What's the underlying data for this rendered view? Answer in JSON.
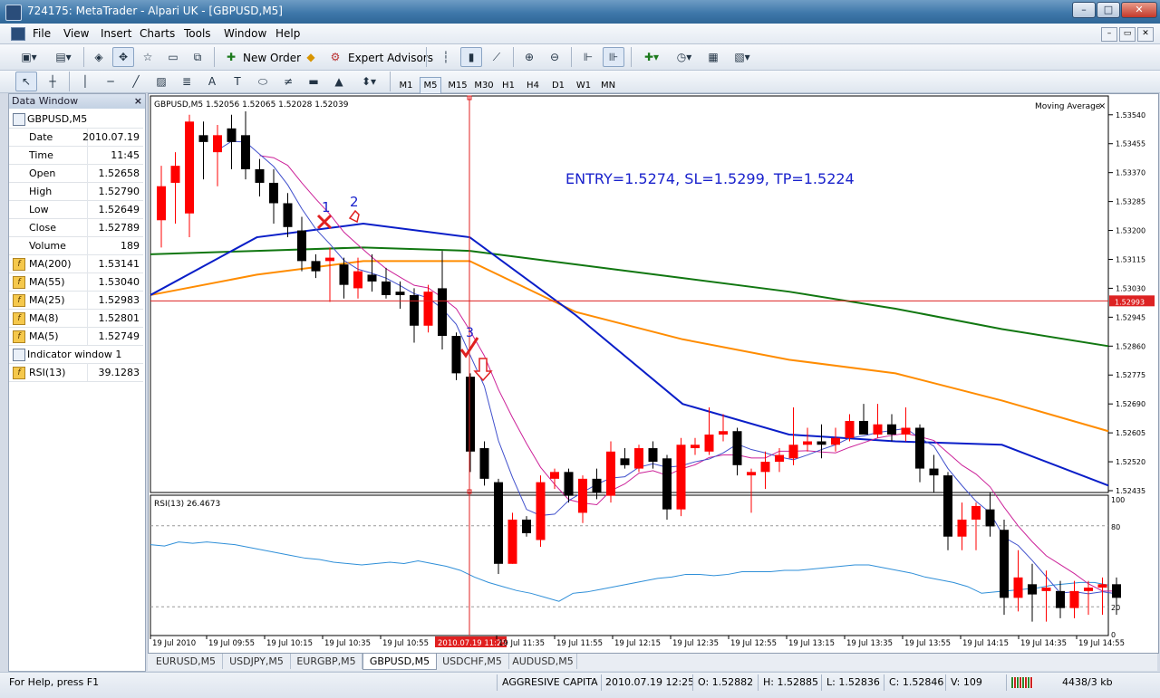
{
  "window": {
    "title": "724175: MetaTrader - Alpari UK - [GBPUSD,M5]",
    "min_label": "–",
    "max_label": "□",
    "close_label": "✕"
  },
  "menu": [
    "File",
    "View",
    "Insert",
    "Charts",
    "Tools",
    "Window",
    "Help"
  ],
  "mdi_controls": [
    "–",
    "▭",
    "✕"
  ],
  "toolbar": {
    "new_order": "New Order",
    "expert_advisors": "Expert Advisors",
    "timeframes": [
      "M1",
      "M5",
      "M15",
      "M30",
      "H1",
      "H4",
      "D1",
      "W1",
      "MN"
    ],
    "active_timeframe": "M5"
  },
  "data_window": {
    "title": "Data Window",
    "close": "×",
    "symbol": "GBPUSD,M5",
    "rows": [
      {
        "label": "Date",
        "value": "2010.07.19"
      },
      {
        "label": "Time",
        "value": "11:45"
      },
      {
        "label": "Open",
        "value": "1.52658"
      },
      {
        "label": "High",
        "value": "1.52790"
      },
      {
        "label": "Low",
        "value": "1.52649"
      },
      {
        "label": "Close",
        "value": "1.52789"
      },
      {
        "label": "Volume",
        "value": "189"
      }
    ],
    "indicators": [
      {
        "label": "MA(200)",
        "value": "1.53141"
      },
      {
        "label": "MA(55)",
        "value": "1.53040"
      },
      {
        "label": "MA(25)",
        "value": "1.52983"
      },
      {
        "label": "MA(8)",
        "value": "1.52801"
      },
      {
        "label": "MA(5)",
        "value": "1.52749"
      }
    ],
    "indicator_window": "Indicator window 1",
    "rsi": {
      "label": "RSI(13)",
      "value": "39.1283"
    }
  },
  "chart": {
    "header": "GBPUSD,M5  1.52056 1.52065 1.52028 1.52039",
    "indicator_label": "Moving Average",
    "indicator_close": "×",
    "annotation": "ENTRY=1.5274,  SL=1.5299, TP=1.5224",
    "marks": [
      "1",
      "2",
      "3"
    ],
    "price_labels": [
      "1.53540",
      "1.53455",
      "1.53370",
      "1.53285",
      "1.53200",
      "1.53115",
      "1.53030",
      "1.52945",
      "1.52860",
      "1.52775",
      "1.52690",
      "1.52605",
      "1.52520",
      "1.52435"
    ],
    "sl_price_tag": "1.52993",
    "rsi_header": "RSI(13) 26.4673",
    "rsi_scale": [
      "100",
      "80",
      "20",
      "0"
    ],
    "time_labels": [
      "19 Jul 2010",
      "19 Jul 09:55",
      "19 Jul 10:15",
      "19 Jul 10:35",
      "19 Jul 10:55",
      "2010.07.19 11:25",
      "19 Jul 11:35",
      "19 Jul 11:55",
      "19 Jul 12:15",
      "19 Jul 12:35",
      "19 Jul 12:55",
      "19 Jul 13:15",
      "19 Jul 13:35",
      "19 Jul 13:55",
      "19 Jul 14:15",
      "19 Jul 14:35",
      "19 Jul 14:55"
    ],
    "colors": {
      "bull": "#ff0000",
      "bear": "#000000",
      "ma200": "#117711",
      "ma55": "#ff8c00",
      "ma25": "#0a1ec8",
      "ma8": "#cc2299",
      "ma5": "#4050cc",
      "rsi": "#2f8fd8",
      "sl_line": "#dd2222",
      "annotation": "#1a22cc"
    }
  },
  "chart_data": {
    "type": "candlestick",
    "price_range": [
      1.52435,
      1.5359
    ],
    "candles": [
      {
        "o": 1.5323,
        "h": 1.5339,
        "l": 1.5315,
        "c": 1.5333
      },
      {
        "o": 1.5334,
        "h": 1.5343,
        "l": 1.5322,
        "c": 1.5339
      },
      {
        "o": 1.5325,
        "h": 1.5354,
        "l": 1.5318,
        "c": 1.5352
      },
      {
        "o": 1.5348,
        "h": 1.5352,
        "l": 1.5335,
        "c": 1.5346
      },
      {
        "o": 1.5343,
        "h": 1.5351,
        "l": 1.5333,
        "c": 1.5348
      },
      {
        "o": 1.535,
        "h": 1.5354,
        "l": 1.5338,
        "c": 1.5346
      },
      {
        "o": 1.5348,
        "h": 1.5355,
        "l": 1.5335,
        "c": 1.5338
      },
      {
        "o": 1.5338,
        "h": 1.5341,
        "l": 1.533,
        "c": 1.5334
      },
      {
        "o": 1.5334,
        "h": 1.5338,
        "l": 1.5322,
        "c": 1.5328
      },
      {
        "o": 1.5328,
        "h": 1.5331,
        "l": 1.5318,
        "c": 1.5321
      },
      {
        "o": 1.532,
        "h": 1.5324,
        "l": 1.5308,
        "c": 1.5311
      },
      {
        "o": 1.5311,
        "h": 1.5313,
        "l": 1.5306,
        "c": 1.5308
      },
      {
        "o": 1.5311,
        "h": 1.5315,
        "l": 1.5299,
        "c": 1.5312
      },
      {
        "o": 1.531,
        "h": 1.5312,
        "l": 1.53,
        "c": 1.5304
      },
      {
        "o": 1.5303,
        "h": 1.5312,
        "l": 1.53,
        "c": 1.5308
      },
      {
        "o": 1.5307,
        "h": 1.5313,
        "l": 1.5302,
        "c": 1.5305
      },
      {
        "o": 1.5305,
        "h": 1.5309,
        "l": 1.53,
        "c": 1.5301
      },
      {
        "o": 1.5302,
        "h": 1.5305,
        "l": 1.5297,
        "c": 1.5301
      },
      {
        "o": 1.5301,
        "h": 1.5303,
        "l": 1.5287,
        "c": 1.5292
      },
      {
        "o": 1.5292,
        "h": 1.5304,
        "l": 1.529,
        "c": 1.5302
      },
      {
        "o": 1.5303,
        "h": 1.5314,
        "l": 1.5285,
        "c": 1.5289
      },
      {
        "o": 1.5289,
        "h": 1.529,
        "l": 1.5276,
        "c": 1.5278
      },
      {
        "o": 1.5277,
        "h": 1.5278,
        "l": 1.5249,
        "c": 1.5255
      },
      {
        "o": 1.5256,
        "h": 1.5258,
        "l": 1.5245,
        "c": 1.5247
      },
      {
        "o": 1.5246,
        "h": 1.5247,
        "l": 1.5219,
        "c": 1.5222
      },
      {
        "o": 1.5222,
        "h": 1.5237,
        "l": 1.5222,
        "c": 1.5235
      },
      {
        "o": 1.5235,
        "h": 1.5236,
        "l": 1.523,
        "c": 1.5231
      },
      {
        "o": 1.5229,
        "h": 1.5248,
        "l": 1.5227,
        "c": 1.5246
      },
      {
        "o": 1.5247,
        "h": 1.525,
        "l": 1.5244,
        "c": 1.5249
      },
      {
        "o": 1.5249,
        "h": 1.525,
        "l": 1.524,
        "c": 1.5242
      },
      {
        "o": 1.5237,
        "h": 1.5248,
        "l": 1.5234,
        "c": 1.5247
      },
      {
        "o": 1.5247,
        "h": 1.525,
        "l": 1.5241,
        "c": 1.5243
      },
      {
        "o": 1.5242,
        "h": 1.5258,
        "l": 1.524,
        "c": 1.5255
      },
      {
        "o": 1.5253,
        "h": 1.5256,
        "l": 1.525,
        "c": 1.5251
      },
      {
        "o": 1.525,
        "h": 1.5257,
        "l": 1.5249,
        "c": 1.5256
      },
      {
        "o": 1.5256,
        "h": 1.5258,
        "l": 1.525,
        "c": 1.5252
      },
      {
        "o": 1.5253,
        "h": 1.5254,
        "l": 1.5235,
        "c": 1.5238
      },
      {
        "o": 1.5238,
        "h": 1.5259,
        "l": 1.5236,
        "c": 1.5257
      },
      {
        "o": 1.5256,
        "h": 1.5259,
        "l": 1.5254,
        "c": 1.5257
      },
      {
        "o": 1.5255,
        "h": 1.5268,
        "l": 1.5254,
        "c": 1.526
      },
      {
        "o": 1.526,
        "h": 1.5266,
        "l": 1.5258,
        "c": 1.5261
      },
      {
        "o": 1.5261,
        "h": 1.5262,
        "l": 1.5248,
        "c": 1.5251
      },
      {
        "o": 1.5248,
        "h": 1.525,
        "l": 1.5237,
        "c": 1.5249
      },
      {
        "o": 1.5249,
        "h": 1.5255,
        "l": 1.5244,
        "c": 1.5252
      },
      {
        "o": 1.5252,
        "h": 1.5256,
        "l": 1.5249,
        "c": 1.5254
      },
      {
        "o": 1.5253,
        "h": 1.5268,
        "l": 1.5251,
        "c": 1.5257
      },
      {
        "o": 1.5257,
        "h": 1.5262,
        "l": 1.5255,
        "c": 1.5258
      },
      {
        "o": 1.5258,
        "h": 1.5263,
        "l": 1.5253,
        "c": 1.5257
      },
      {
        "o": 1.5257,
        "h": 1.5262,
        "l": 1.5255,
        "c": 1.5259
      },
      {
        "o": 1.5259,
        "h": 1.5266,
        "l": 1.5258,
        "c": 1.5264
      },
      {
        "o": 1.5264,
        "h": 1.5269,
        "l": 1.526,
        "c": 1.526
      },
      {
        "o": 1.526,
        "h": 1.5269,
        "l": 1.5259,
        "c": 1.5263
      },
      {
        "o": 1.5263,
        "h": 1.5266,
        "l": 1.5258,
        "c": 1.526
      },
      {
        "o": 1.526,
        "h": 1.5268,
        "l": 1.5258,
        "c": 1.5262
      },
      {
        "o": 1.5262,
        "h": 1.5263,
        "l": 1.5246,
        "c": 1.525
      },
      {
        "o": 1.525,
        "h": 1.5254,
        "l": 1.5243,
        "c": 1.5248
      },
      {
        "o": 1.5248,
        "h": 1.5249,
        "l": 1.5226,
        "c": 1.523
      },
      {
        "o": 1.523,
        "h": 1.524,
        "l": 1.5226,
        "c": 1.5235
      },
      {
        "o": 1.5235,
        "h": 1.524,
        "l": 1.5226,
        "c": 1.5239
      },
      {
        "o": 1.5238,
        "h": 1.5243,
        "l": 1.523,
        "c": 1.5233
      },
      {
        "o": 1.5232,
        "h": 1.5235,
        "l": 1.5207,
        "c": 1.5212
      },
      {
        "o": 1.5212,
        "h": 1.5226,
        "l": 1.5208,
        "c": 1.5218
      },
      {
        "o": 1.5216,
        "h": 1.5222,
        "l": 1.5205,
        "c": 1.5213
      },
      {
        "o": 1.5214,
        "h": 1.522,
        "l": 1.5205,
        "c": 1.5215
      },
      {
        "o": 1.5214,
        "h": 1.5217,
        "l": 1.5206,
        "c": 1.5209
      },
      {
        "o": 1.5209,
        "h": 1.5217,
        "l": 1.5206,
        "c": 1.5214
      },
      {
        "o": 1.5214,
        "h": 1.5217,
        "l": 1.5207,
        "c": 1.5215
      },
      {
        "o": 1.5215,
        "h": 1.5218,
        "l": 1.5207,
        "c": 1.5216
      },
      {
        "o": 1.5216,
        "h": 1.5218,
        "l": 1.5207,
        "c": 1.5212
      }
    ],
    "moving_averages": [
      {
        "name": "MA(200)",
        "values": [
          1.5313,
          1.5314,
          1.5315,
          1.5314,
          1.531,
          1.5306,
          1.5302,
          1.5297,
          1.5291,
          1.5286
        ]
      },
      {
        "name": "MA(55)",
        "values": [
          1.5301,
          1.5307,
          1.5311,
          1.5311,
          1.5296,
          1.5288,
          1.5282,
          1.5278,
          1.527,
          1.5261
        ]
      },
      {
        "name": "MA(25)",
        "values": [
          1.5301,
          1.5318,
          1.5322,
          1.5318,
          1.5295,
          1.5269,
          1.526,
          1.5258,
          1.5257,
          1.5245
        ]
      }
    ],
    "rsi": {
      "name": "RSI(13)",
      "range": [
        0,
        100
      ],
      "levels": [
        80,
        20
      ],
      "values": [
        66,
        65,
        68,
        67,
        68,
        67,
        66,
        64,
        62,
        60,
        58,
        56,
        55,
        53,
        52,
        51,
        52,
        53,
        52,
        54,
        52,
        50,
        47,
        42,
        38,
        35,
        32,
        30,
        27,
        24,
        30,
        31,
        33,
        35,
        37,
        39,
        41,
        42,
        44,
        44,
        43,
        44,
        46,
        46,
        46,
        47,
        47,
        48,
        49,
        50,
        51,
        51,
        49,
        47,
        45,
        42,
        40,
        38,
        35,
        30,
        31,
        32,
        33,
        34,
        36,
        37,
        38,
        38,
        36
      ]
    },
    "sl_level": 1.52993,
    "xlabel": "",
    "ylabel": ""
  },
  "tabs": [
    "EURUSD,M5",
    "USDJPY,M5",
    "EURGBP,M5",
    "GBPUSD,M5",
    "USDCHF,M5",
    "AUDUSD,M5"
  ],
  "active_tab": "GBPUSD,M5",
  "status": {
    "help": "For Help, press F1",
    "profile": "AGGRESIVE CAPITAL T",
    "datetime": "2010.07.19 12:25",
    "o": "O: 1.52882",
    "h": "H: 1.52885",
    "l": "L: 1.52836",
    "c": "C: 1.52846",
    "v": "V: 109",
    "traffic": "4438/3 kb"
  }
}
